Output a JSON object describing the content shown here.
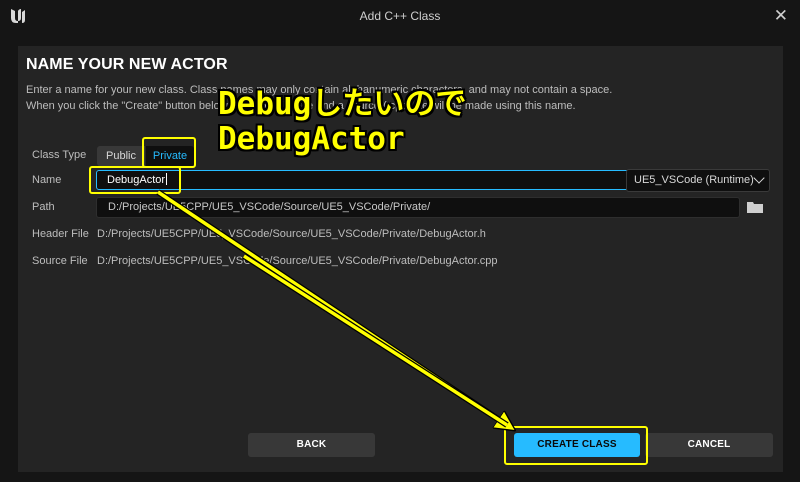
{
  "window": {
    "title": "Add C++ Class",
    "close_glyph": "✕",
    "logo_icon": "unreal-engine-logo-icon",
    "close_icon": "close-icon"
  },
  "page": {
    "heading": "NAME YOUR NEW ACTOR",
    "description_line1": "Enter a name for your new class. Class names may only contain alphanumeric characters, and may not contain a space.",
    "description_line2": "When you click the \"Create\" button below, a header (.h) file and a source (.cpp) file will be made using this name."
  },
  "form": {
    "class_type_label": "Class Type",
    "class_type_options": [
      "Public",
      "Private"
    ],
    "class_type_selected": "Private",
    "name_label": "Name",
    "name_value": "DebugActor",
    "module_value": "UE5_VSCode (Runtime)",
    "path_label": "Path",
    "path_value": "D:/Projects/UE5CPP/UE5_VSCode/Source/UE5_VSCode/Private/",
    "header_file_label": "Header File",
    "header_file_value": "D:/Projects/UE5CPP/UE5_VSCode/Source/UE5_VSCode/Private/DebugActor.h",
    "source_file_label": "Source File",
    "source_file_value": "D:/Projects/UE5CPP/UE5_VSCode/Source/UE5_VSCode/Private/DebugActor.cpp"
  },
  "buttons": {
    "back": "BACK",
    "create": "CREATE CLASS",
    "cancel": "CANCEL"
  },
  "annotation": {
    "line1": "Debugしたいので",
    "line2": "DebugActor",
    "color": "#ffff00"
  },
  "colors": {
    "accent": "#26bbff",
    "panel": "#242424",
    "background": "#151515"
  }
}
